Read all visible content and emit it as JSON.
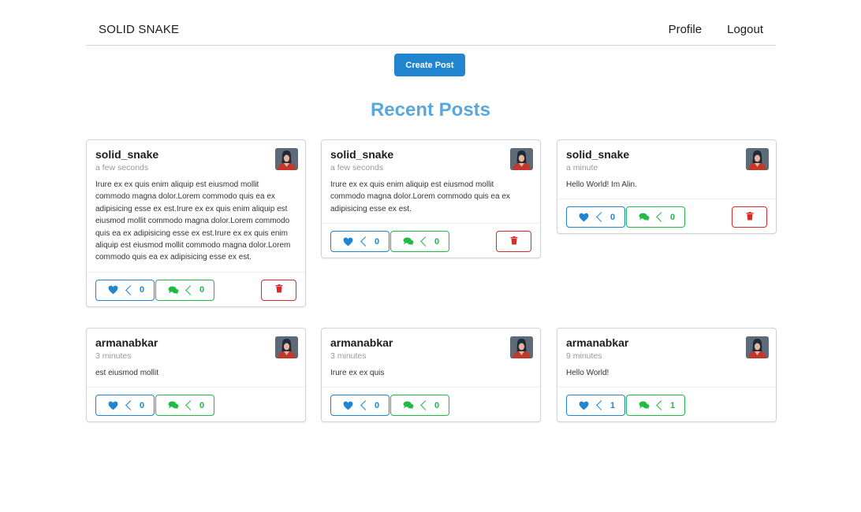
{
  "header": {
    "brand": "SOLID SNAKE",
    "profile_label": "Profile",
    "logout_label": "Logout"
  },
  "actions": {
    "create_post_label": "Create Post"
  },
  "page": {
    "title": "Recent Posts"
  },
  "colors": {
    "primary": "#2185d0",
    "positive": "#21ba45",
    "negative": "#db2828",
    "title": "#5aa7dc"
  },
  "posts": [
    {
      "author": "solid_snake",
      "time": "a few seconds",
      "body": "Irure ex ex quis enim aliquip est eiusmod mollit commodo magna dolor.Lorem commodo quis ea ex adipisicing esse ex est.Irure ex ex quis enim aliquip est eiusmod mollit commodo magna dolor.Lorem commodo quis ea ex adipisicing esse ex est.Irure ex ex quis enim aliquip est eiusmod mollit commodo magna dolor.Lorem commodo quis ea ex adipisicing esse ex est.",
      "likes": "0",
      "comments": "0",
      "deletable": true,
      "like_icon": "heart-icon",
      "comment_icon": "comments-icon",
      "delete_icon": "trash-icon"
    },
    {
      "author": "solid_snake",
      "time": "a few seconds",
      "body": "Irure ex ex quis enim aliquip est eiusmod mollit commodo magna dolor.Lorem commodo quis ea ex adipisicing esse ex est.",
      "likes": "0",
      "comments": "0",
      "deletable": true,
      "like_icon": "heart-icon",
      "comment_icon": "comments-icon",
      "delete_icon": "trash-icon"
    },
    {
      "author": "solid_snake",
      "time": "a minute",
      "body": "Hello World! Im Alin.",
      "likes": "0",
      "comments": "0",
      "deletable": true,
      "like_icon": "heart-icon",
      "comment_icon": "comments-icon",
      "delete_icon": "trash-icon"
    },
    {
      "author": "armanabkar",
      "time": "3 minutes",
      "body": "est eiusmod mollit",
      "likes": "0",
      "comments": "0",
      "deletable": false,
      "like_icon": "heart-icon",
      "comment_icon": "comments-icon"
    },
    {
      "author": "armanabkar",
      "time": "3 minutes",
      "body": "Irure ex ex quis",
      "likes": "0",
      "comments": "0",
      "deletable": false,
      "like_icon": "heart-icon",
      "comment_icon": "comments-icon"
    },
    {
      "author": "armanabkar",
      "time": "9 minutes",
      "body": "Hello World!",
      "likes": "1",
      "comments": "1",
      "deletable": false,
      "like_icon": "heart-icon",
      "comment_icon": "comments-icon"
    }
  ]
}
